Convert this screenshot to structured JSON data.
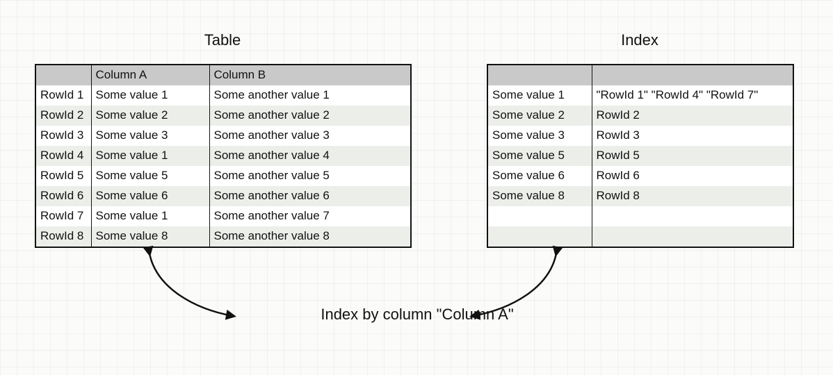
{
  "titles": {
    "left": "Table",
    "right": "Index"
  },
  "left_table": {
    "headers": [
      "",
      "Column A",
      "Column B"
    ],
    "rows": [
      [
        "RowId 1",
        "Some value 1",
        "Some another value 1"
      ],
      [
        "RowId 2",
        "Some value 2",
        "Some another value 2"
      ],
      [
        "RowId 3",
        "Some value 3",
        "Some another value 3"
      ],
      [
        "RowId 4",
        "Some value 1",
        "Some another value 4"
      ],
      [
        "RowId 5",
        "Some value 5",
        "Some another value 5"
      ],
      [
        "RowId 6",
        "Some value 6",
        "Some another value 6"
      ],
      [
        "RowId 7",
        "Some value 1",
        "Some another value 7"
      ],
      [
        "RowId 8",
        "Some value 8",
        "Some another value 8"
      ]
    ]
  },
  "right_table": {
    "headers": [
      "",
      ""
    ],
    "rows": [
      [
        "Some value 1",
        "\"RowId 1\" \"RowId 4\" \"RowId 7\""
      ],
      [
        "Some value 2",
        "RowId 2"
      ],
      [
        "Some value 3",
        "RowId 3"
      ],
      [
        "Some value 5",
        "RowId 5"
      ],
      [
        "Some value 6",
        "RowId 6"
      ],
      [
        "Some value 8",
        "RowId 8"
      ],
      [
        "",
        ""
      ],
      [
        "",
        ""
      ]
    ]
  },
  "caption": "Index by column \"Column A\""
}
